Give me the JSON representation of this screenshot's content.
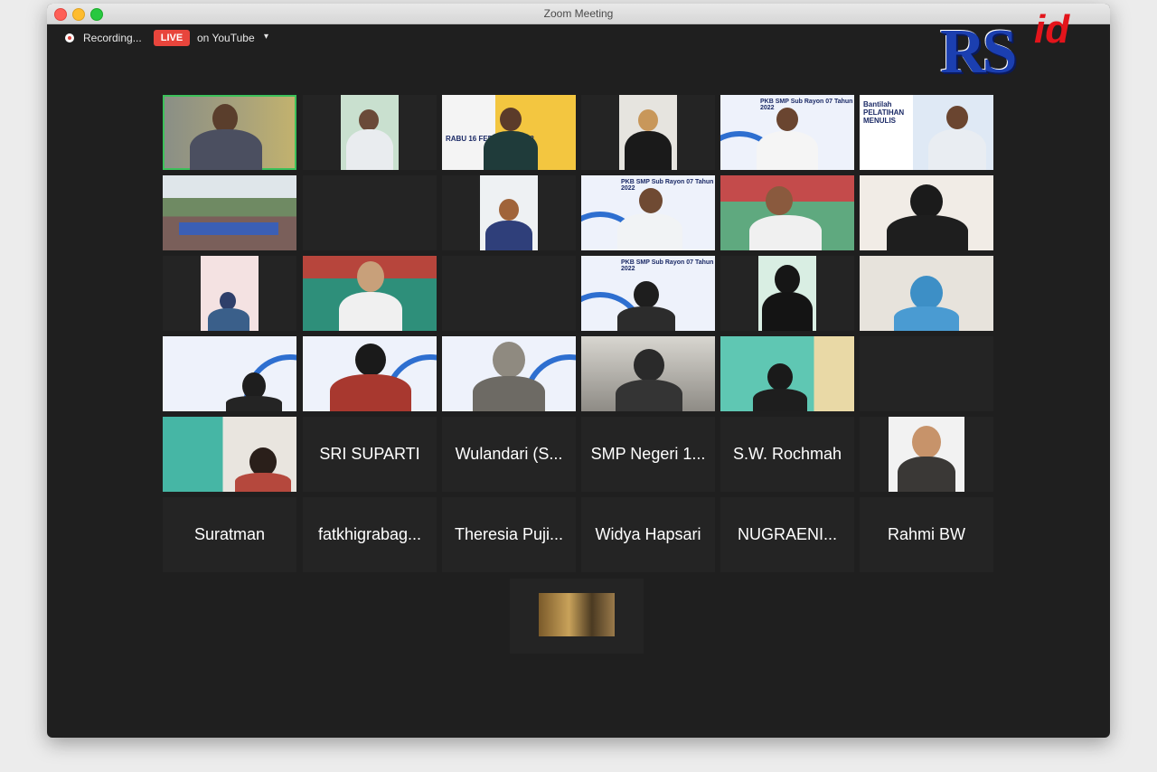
{
  "window": {
    "title": "Zoom Meeting"
  },
  "topbar": {
    "recording_label": "Recording...",
    "live_badge": "LIVE",
    "stream_label": "on YouTube",
    "stream_caret": "▾"
  },
  "logo": {
    "main": "RS",
    "suffix": "id"
  },
  "video_banners": {
    "banner_a": "PKB SMP Sub Rayon 07 Tahun 2022",
    "banner_b": "Bantilah PELATIHAN MENULIS",
    "banner_c": "RABU 16 FEBRUARI 2022"
  },
  "name_tiles": [
    "SRI SUPARTI",
    "Wulandari (S...",
    "SMP Negeri 1...",
    "S.W. Rochmah",
    "Suratman",
    "fatkhigrabag...",
    "Theresia Puji...",
    "Widya Hapsari",
    "NUGRAENI...",
    "Rahmi BW"
  ],
  "colors": {
    "window_bg": "#1f1f1f",
    "tile_bg": "#242424",
    "active_speaker": "#3cc15a",
    "live_red": "#e8453c"
  }
}
